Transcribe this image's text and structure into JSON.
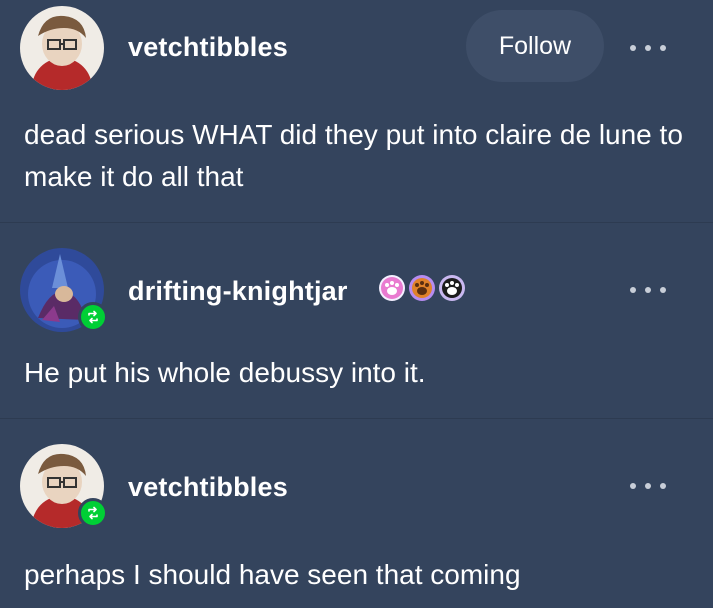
{
  "posts": [
    {
      "username": "vetchtibbles",
      "follow_label": "Follow",
      "text": "dead serious WHAT did they put into claire de lune to make it do all that"
    },
    {
      "username": "drifting-knightjar",
      "text": "He put his whole debussy into it."
    },
    {
      "username": "vetchtibbles",
      "text": "perhaps I should have seen that coming"
    }
  ],
  "colors": {
    "background": "#34445d",
    "follow_button_bg": "#3e4e68",
    "reblog_green": "#00cf35",
    "text": "#ffffff"
  },
  "icons": {
    "more": "more-options-icon",
    "reblog": "reblog-icon",
    "badges": [
      "pink-paw-badge",
      "orange-paw-badge",
      "black-paw-badge"
    ]
  }
}
